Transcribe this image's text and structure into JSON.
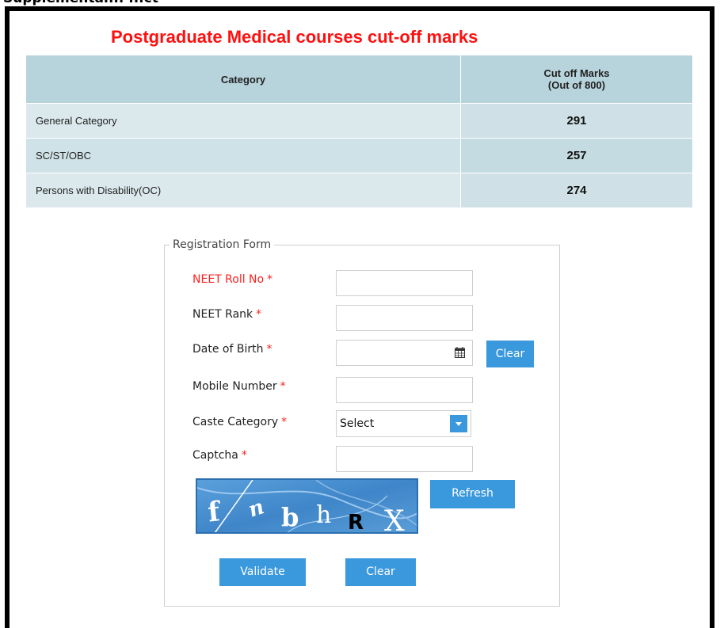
{
  "header_fragment": "Supplementar...  ...ct",
  "title": "Postgraduate Medical courses cut-off marks",
  "table": {
    "headers": {
      "category": "Category",
      "marks_line1": "Cut off Marks",
      "marks_line2": "(Out of 800)"
    },
    "rows": [
      {
        "category": "General Category",
        "marks": "291"
      },
      {
        "category": "SC/ST/OBC",
        "marks": "257"
      },
      {
        "category": "Persons with Disability(OC)",
        "marks": "274"
      }
    ]
  },
  "form": {
    "legend": "Registration Form",
    "required_mark": "*",
    "fields": {
      "roll_no": {
        "label": "NEET Roll No",
        "value": ""
      },
      "rank": {
        "label": "NEET Rank",
        "value": ""
      },
      "dob": {
        "label": "Date of Birth",
        "value": "",
        "icon": "calendar-icon"
      },
      "mobile": {
        "label": "Mobile Number",
        "value": ""
      },
      "caste": {
        "label": "Caste Category",
        "selected": "Select",
        "icon": "chevron-down-icon"
      },
      "captcha": {
        "label": "Captcha",
        "value": ""
      }
    },
    "captcha_text": "f n b h R X",
    "buttons": {
      "dob_clear": "Clear",
      "refresh": "Refresh",
      "validate": "Validate",
      "clear": "Clear"
    }
  },
  "colors": {
    "title": "#ff1010",
    "header_bg": "#b7d3db",
    "row_bg": "#dbe9ed",
    "button": "#3a98dd",
    "required": "#ff2020"
  }
}
